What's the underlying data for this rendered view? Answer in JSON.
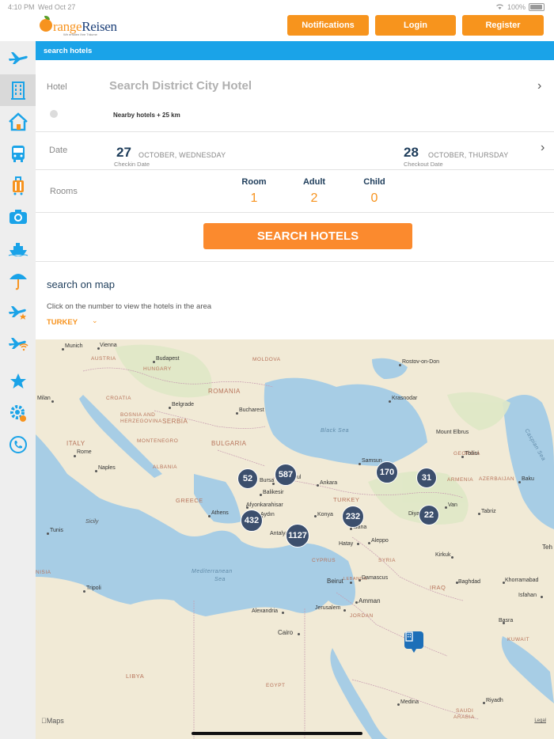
{
  "status_bar": {
    "time": "4:10 PM",
    "date": "Wed Oct 27",
    "battery": "100%"
  },
  "header": {
    "logo_orange": "range",
    "logo_reisen": "Reisen",
    "logo_tagline": "Wir erfüllen Ihre Träume",
    "buttons": {
      "notifications": "Notifications",
      "login": "Login",
      "register": "Register"
    }
  },
  "sidebar": {
    "items": [
      "airplane-icon",
      "hotel-building-icon",
      "home-icon",
      "bus-icon",
      "luggage-icon",
      "camera-icon",
      "cruise-ship-icon",
      "umbrella-icon",
      "flight-star-icon",
      "flight-wifi-icon",
      "star-icon",
      "settings-icon",
      "phone-icon"
    ],
    "active_index": 1
  },
  "blue_bar": {
    "title": "search hotels"
  },
  "hotel_row": {
    "label": "Hotel",
    "placeholder": "Search District City Hotel",
    "nearby": "Nearby hotels + 25 km"
  },
  "date_row": {
    "label": "Date",
    "checkin": {
      "day": "27",
      "text": "OCTOBER, WEDNESDAY",
      "sub": "Checkin Date"
    },
    "checkout": {
      "day": "28",
      "text": "OCTOBER, THURSDAY",
      "sub": "Checkout Date"
    }
  },
  "rooms_row": {
    "label": "Rooms",
    "room": {
      "label": "Room",
      "value": "1"
    },
    "adult": {
      "label": "Adult",
      "value": "2"
    },
    "child": {
      "label": "Child",
      "value": "0"
    }
  },
  "search_button": "SEARCH HOTELS",
  "map_section": {
    "title": "search on map",
    "info": "Click on the number to view the hotels in the area",
    "country": "TURKEY",
    "attribution": "Maps",
    "legal": "Legal",
    "clusters": [
      "52",
      "587",
      "170",
      "31",
      "232",
      "22",
      "432",
      "1127"
    ],
    "places": {
      "munich": "Munich",
      "vienna": "Vienna",
      "budapest": "Budapest",
      "milan": "Milan",
      "belgrade": "Belgrade",
      "bucharest": "Bucharest",
      "rome": "Rome",
      "naples": "Naples",
      "tunis": "Tunis",
      "tripoli": "Tripoli",
      "athens": "Athens",
      "ankara": "Ankara",
      "samsun": "Samsun",
      "tbilisi": "Tbilisi",
      "baku": "Baku",
      "rostov": "Rostov-on-Don",
      "krasnodar": "Krasnodar",
      "elbrus": "Mount Elbrus",
      "bursa": "Bursa",
      "balikesir": "Balikesir",
      "afyon": "Afyonkarahisar",
      "aydin": "Aydın",
      "konya": "Konya",
      "adana": "Adana",
      "antalya": "Antalya",
      "hatay": "Hatay",
      "aleppo": "Aleppo",
      "diyarbakir": "Diya",
      "van": "Van",
      "tabriz": "Tabriz",
      "kirkuk": "Kirkuk",
      "baghdad": "Baghdad",
      "khorramabad": "Khorramabad",
      "isfahan": "Isfahan",
      "beirut": "Beirut",
      "damascus": "Damascus",
      "amman": "Amman",
      "jerusalem": "Jerusalem",
      "alexandria": "Alexandria",
      "cairo": "Cairo",
      "basra": "Basra",
      "medina": "Medina",
      "riyadh": "Riyadh",
      "sicily": "Sicily",
      "istanbul_tail": "ul",
      "teh": "Teh"
    },
    "regions": {
      "austria": "AUSTRIA",
      "hungary": "HUNGARY",
      "moldova": "MOLDOVA",
      "romania": "ROMANIA",
      "croatia": "CROATIA",
      "bosnia1": "BOSNIA AND",
      "bosnia2": "HERZEGOVINA",
      "serbia": "SERBIA",
      "montenegro": "MONTENEGRO",
      "bulgaria": "BULGARIA",
      "italy": "ITALY",
      "albania": "ALBANIA",
      "greece": "GREECE",
      "turkey": "TURKEY",
      "georgia": "GEORGIA",
      "armenia": "ARMENIA",
      "azerbaijan": "AZERBAIJAN",
      "syria": "SYRIA",
      "iraq": "IRAQ",
      "cyprus": "CYPRUS",
      "lebanon": "LEBANON",
      "jordan": "JORDAN",
      "kuwait": "KUWAIT",
      "libya": "LIBYA",
      "egypt": "EGYPT",
      "saudi1": "SAUDI",
      "saudi2": "ARABIA",
      "tunisia_tail": "NISIA"
    },
    "seas": {
      "black": "Black Sea",
      "med1": "Mediterranean",
      "med2": "Sea",
      "caspian": "Caspian Sea"
    }
  }
}
